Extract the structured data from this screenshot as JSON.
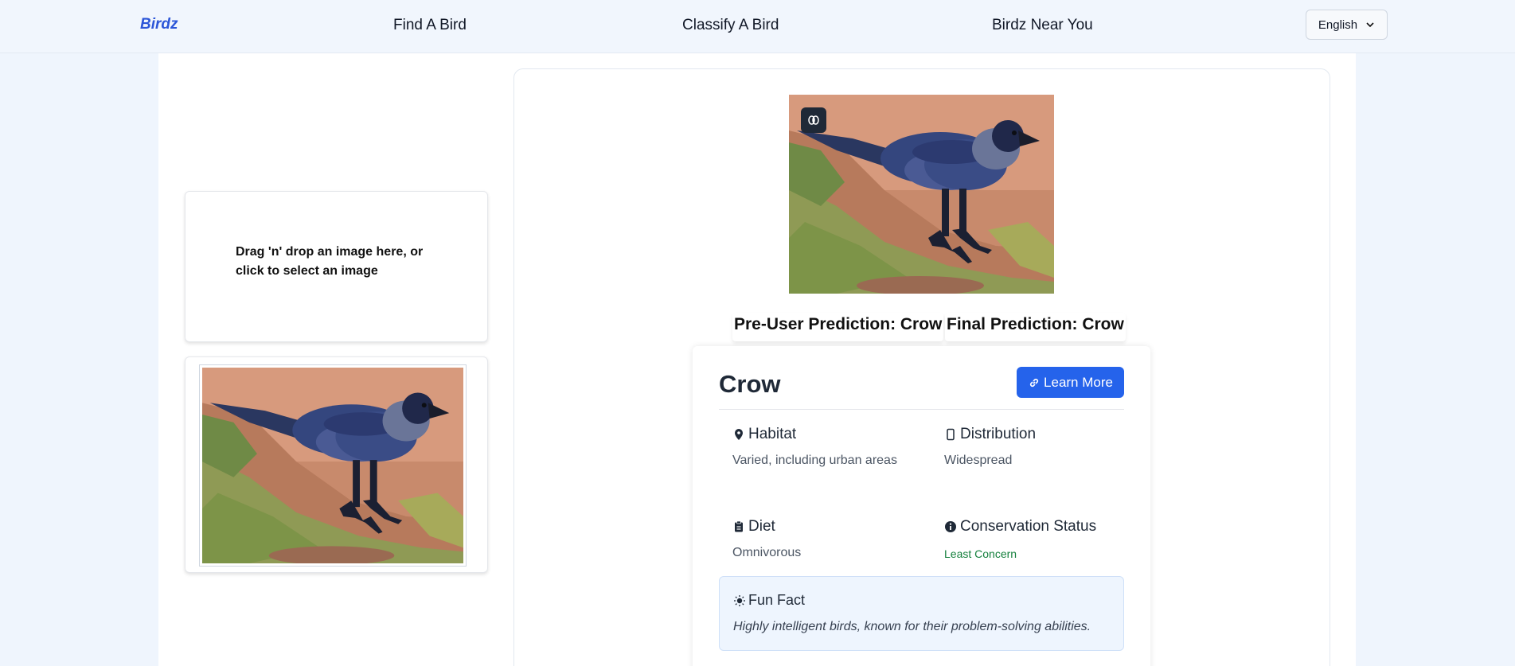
{
  "nav": {
    "brand": "Birdz",
    "links": [
      "Find A Bird",
      "Classify A Bird",
      "Birdz Near You"
    ],
    "language": "English"
  },
  "upload": {
    "dropzone_text": "Drag 'n' drop an image here, or click to select an image"
  },
  "predictions": {
    "pre_user": "Pre-User Prediction: Crow",
    "final": "Final Prediction: Crow"
  },
  "bird": {
    "name": "Crow",
    "learn_more": "Learn More",
    "habitat_label": "Habitat",
    "habitat_value": "Varied, including urban areas",
    "distribution_label": "Distribution",
    "distribution_value": "Widespread",
    "diet_label": "Diet",
    "diet_value": "Omnivorous",
    "conservation_label": "Conservation Status",
    "conservation_value": "Least Concern",
    "fun_fact_label": "Fun Fact",
    "fun_fact_text": "Highly intelligent birds, known for their problem-solving abilities."
  },
  "colors": {
    "brand": "#2c56d8",
    "button": "#2563eb",
    "status_green": "#15803d",
    "page_bg": "#eff5fd"
  },
  "icons": [
    "brain-icon",
    "link-icon",
    "map-pin-icon",
    "smartphone-icon",
    "clipboard-icon",
    "info-icon",
    "lightbulb-icon",
    "chevron-down-icon"
  ]
}
